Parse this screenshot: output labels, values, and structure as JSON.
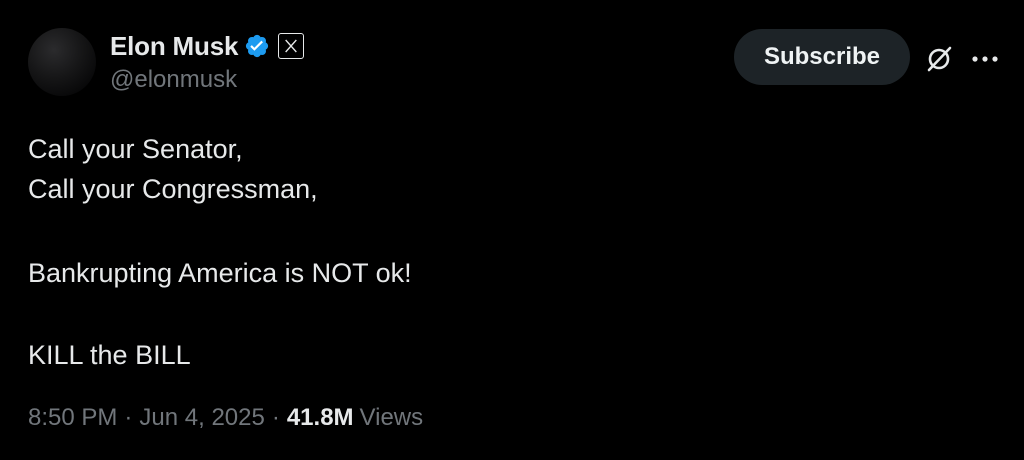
{
  "author": {
    "display_name": "Elon Musk",
    "handle": "@elonmusk",
    "verified_color": "#1d9bf0"
  },
  "actions": {
    "subscribe_label": "Subscribe",
    "grok_icon": "grok-icon",
    "more_icon": "more-icon"
  },
  "post": {
    "lines": [
      "Call your Senator,",
      "Call your Congressman,",
      "Bankrupting America is NOT ok!",
      "KILL the BILL"
    ]
  },
  "meta": {
    "time": "8:50 PM",
    "separator": "·",
    "date": "Jun 4, 2025",
    "views_count": "41.8M",
    "views_label": "Views"
  }
}
